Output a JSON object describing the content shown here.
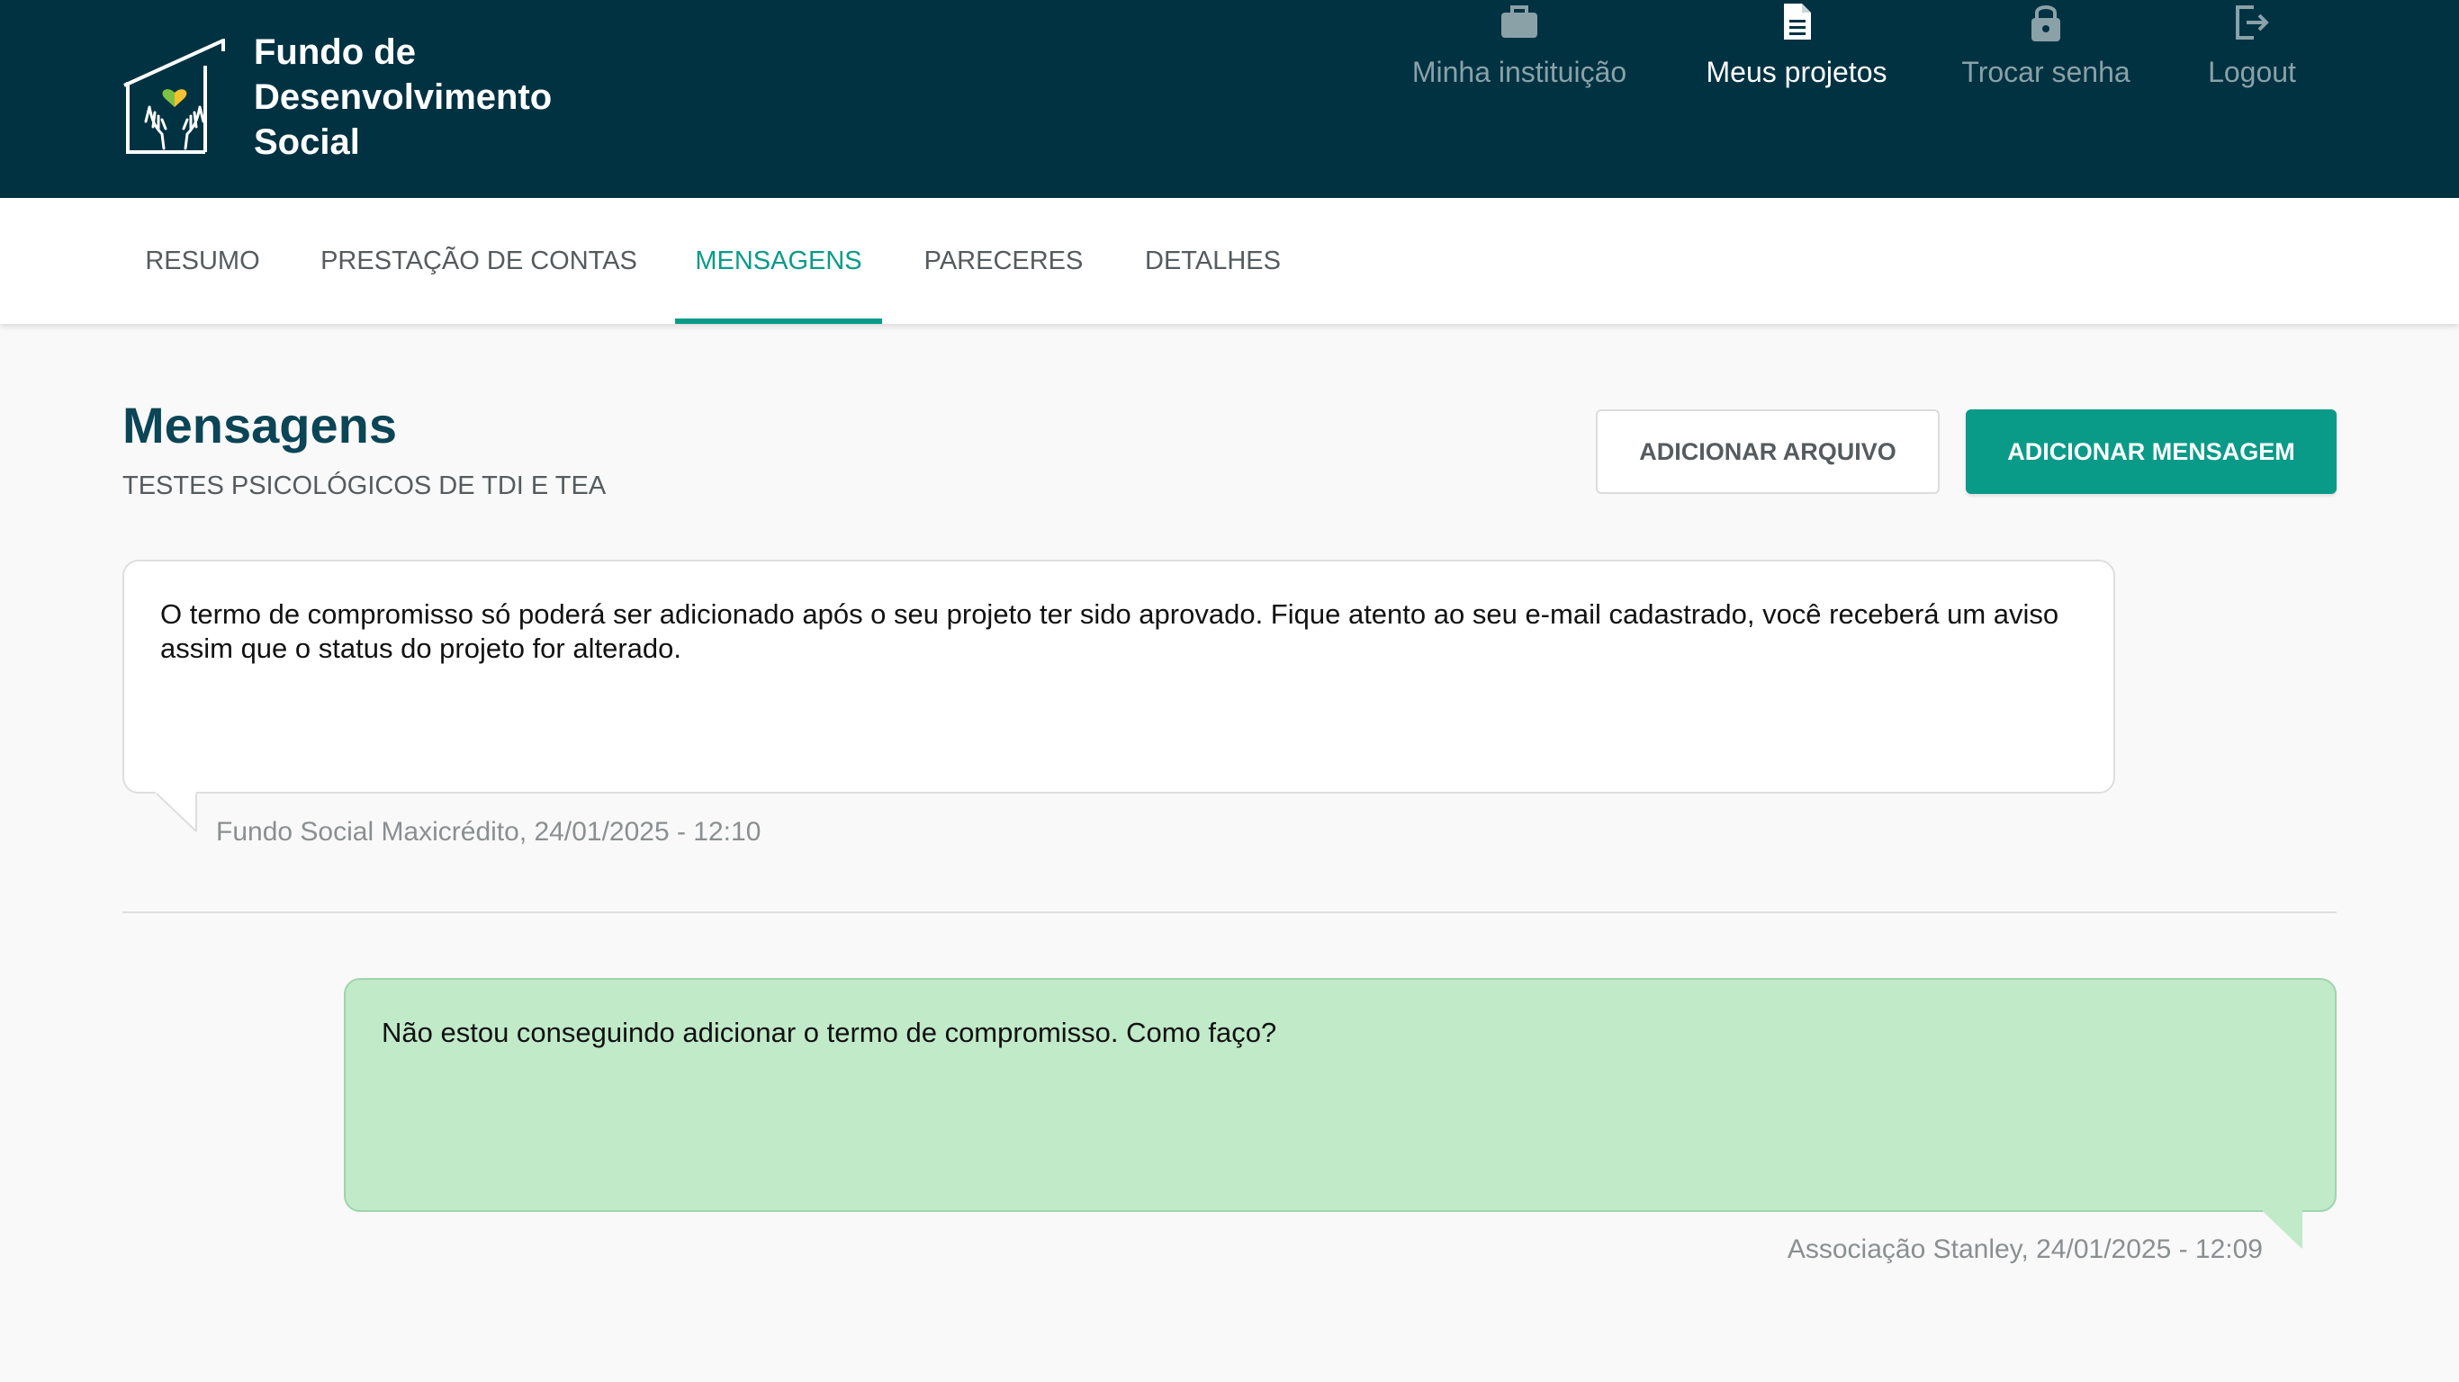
{
  "header": {
    "brand": "Fundo de Desenvolvimento Social",
    "nav": [
      {
        "label": "Minha instituição",
        "icon": "briefcase-icon",
        "active": false
      },
      {
        "label": "Meus projetos",
        "icon": "document-icon",
        "active": true
      },
      {
        "label": "Trocar senha",
        "icon": "lock-icon",
        "active": false
      },
      {
        "label": "Logout",
        "icon": "logout-icon",
        "active": false
      }
    ]
  },
  "tabs": [
    {
      "label": "RESUMO",
      "active": false
    },
    {
      "label": "PRESTAÇÃO DE CONTAS",
      "active": false
    },
    {
      "label": "MENSAGENS",
      "active": true
    },
    {
      "label": "PARECERES",
      "active": false
    },
    {
      "label": "DETALHES",
      "active": false
    }
  ],
  "page": {
    "title": "Mensagens",
    "subtitle": "TESTES PSICOLÓGICOS DE TDI E TEA",
    "add_file_label": "ADICIONAR ARQUIVO",
    "add_message_label": "ADICIONAR MENSAGEM"
  },
  "messages": [
    {
      "text": "O termo de compromisso só poderá ser adicionado após o seu projeto ter sido aprovado. Fique atento ao seu e-mail cadastrado, você receberá um aviso assim que o status do projeto for alterado.",
      "meta": "Fundo Social Maxicrédito, 24/01/2025 - 12:10",
      "side": "left"
    },
    {
      "text": "Não estou conseguindo adicionar o termo de compromisso. Como faço?",
      "meta": "Associação Stanley, 24/01/2025 - 12:09",
      "side": "right"
    }
  ],
  "colors": {
    "header_bg": "#003242",
    "accent": "#0a9b88",
    "title": "#0b4556",
    "own_message_bg": "#c1eac9"
  }
}
